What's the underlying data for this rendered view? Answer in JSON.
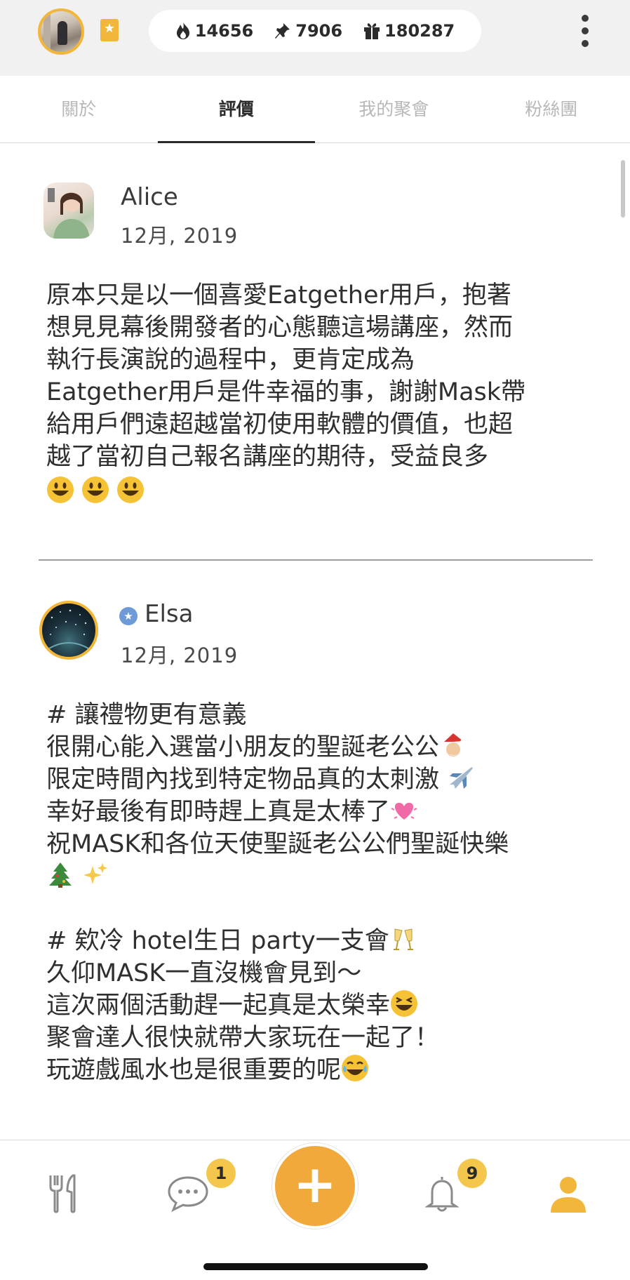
{
  "header": {
    "stats": [
      {
        "icon": "flame-icon",
        "value": "14656"
      },
      {
        "icon": "pin-icon",
        "value": "7906"
      },
      {
        "icon": "gift-icon",
        "value": "180287"
      }
    ]
  },
  "tabs": [
    {
      "label": "關於",
      "active": false
    },
    {
      "label": "評價",
      "active": true
    },
    {
      "label": "我的聚會",
      "active": false
    },
    {
      "label": "粉絲團",
      "active": false
    }
  ],
  "reviews": [
    {
      "name": "Alice",
      "date": "12月, 2019",
      "body": "原本只是以一個喜愛Eatgether用戶，抱著\n想見見幕後開發者的心態聽這場講座，然而\n執行長演說的過程中，更肯定成為\nEatgether用戶是件幸福的事，謝謝Mask帶\n給用戶們遠超越當初使用軟體的價值，也超\n越了當初自己報名講座的期待，受益良多",
      "emojis": [
        "smiley-emoji",
        "smiley-emoji",
        "smiley-emoji"
      ]
    },
    {
      "name": "Elsa",
      "date": "12月, 2019",
      "verified": true,
      "lines": [
        {
          "text": "# 讓禮物更有意義",
          "emoji": ""
        },
        {
          "text": "很開心能入選當小朋友的聖誕老公公",
          "emoji": "santa-emoji"
        },
        {
          "text": "限定時間內找到特定物品真的太刺激 ",
          "emoji": "airplane-emoji"
        },
        {
          "text": "幸好最後有即時趕上真是太棒了",
          "emoji": "heart-emoji"
        },
        {
          "text": "祝MASK和各位天使聖誕老公公們聖誕快樂",
          "emoji": ""
        },
        {
          "text": "",
          "emoji": "tree-sparkles-emoji"
        },
        {
          "text": "",
          "emoji": ""
        },
        {
          "text": "# 欸冷 hotel生日 party一支會",
          "emoji": "champagne-emoji"
        },
        {
          "text": "久仰MASK一直沒機會見到～",
          "emoji": ""
        },
        {
          "text": "這次兩個活動趕一起真是太榮幸",
          "emoji": "laughing-emoji"
        },
        {
          "text": "聚會達人很快就帶大家玩在一起了！",
          "emoji": ""
        },
        {
          "text": "玩遊戲風水也是很重要的呢",
          "emoji": "joy-emoji"
        }
      ]
    }
  ],
  "bottom_nav": {
    "items": [
      {
        "icon": "utensils-icon"
      },
      {
        "icon": "chat-icon",
        "badge": "1"
      },
      {
        "icon": "plus-icon",
        "label": "+"
      },
      {
        "icon": "bell-icon",
        "badge": "9"
      },
      {
        "icon": "profile-icon"
      }
    ]
  },
  "colors": {
    "accent": "#f2a93b",
    "badge": "#f4c64b",
    "active_profile": "#f2b73a"
  }
}
